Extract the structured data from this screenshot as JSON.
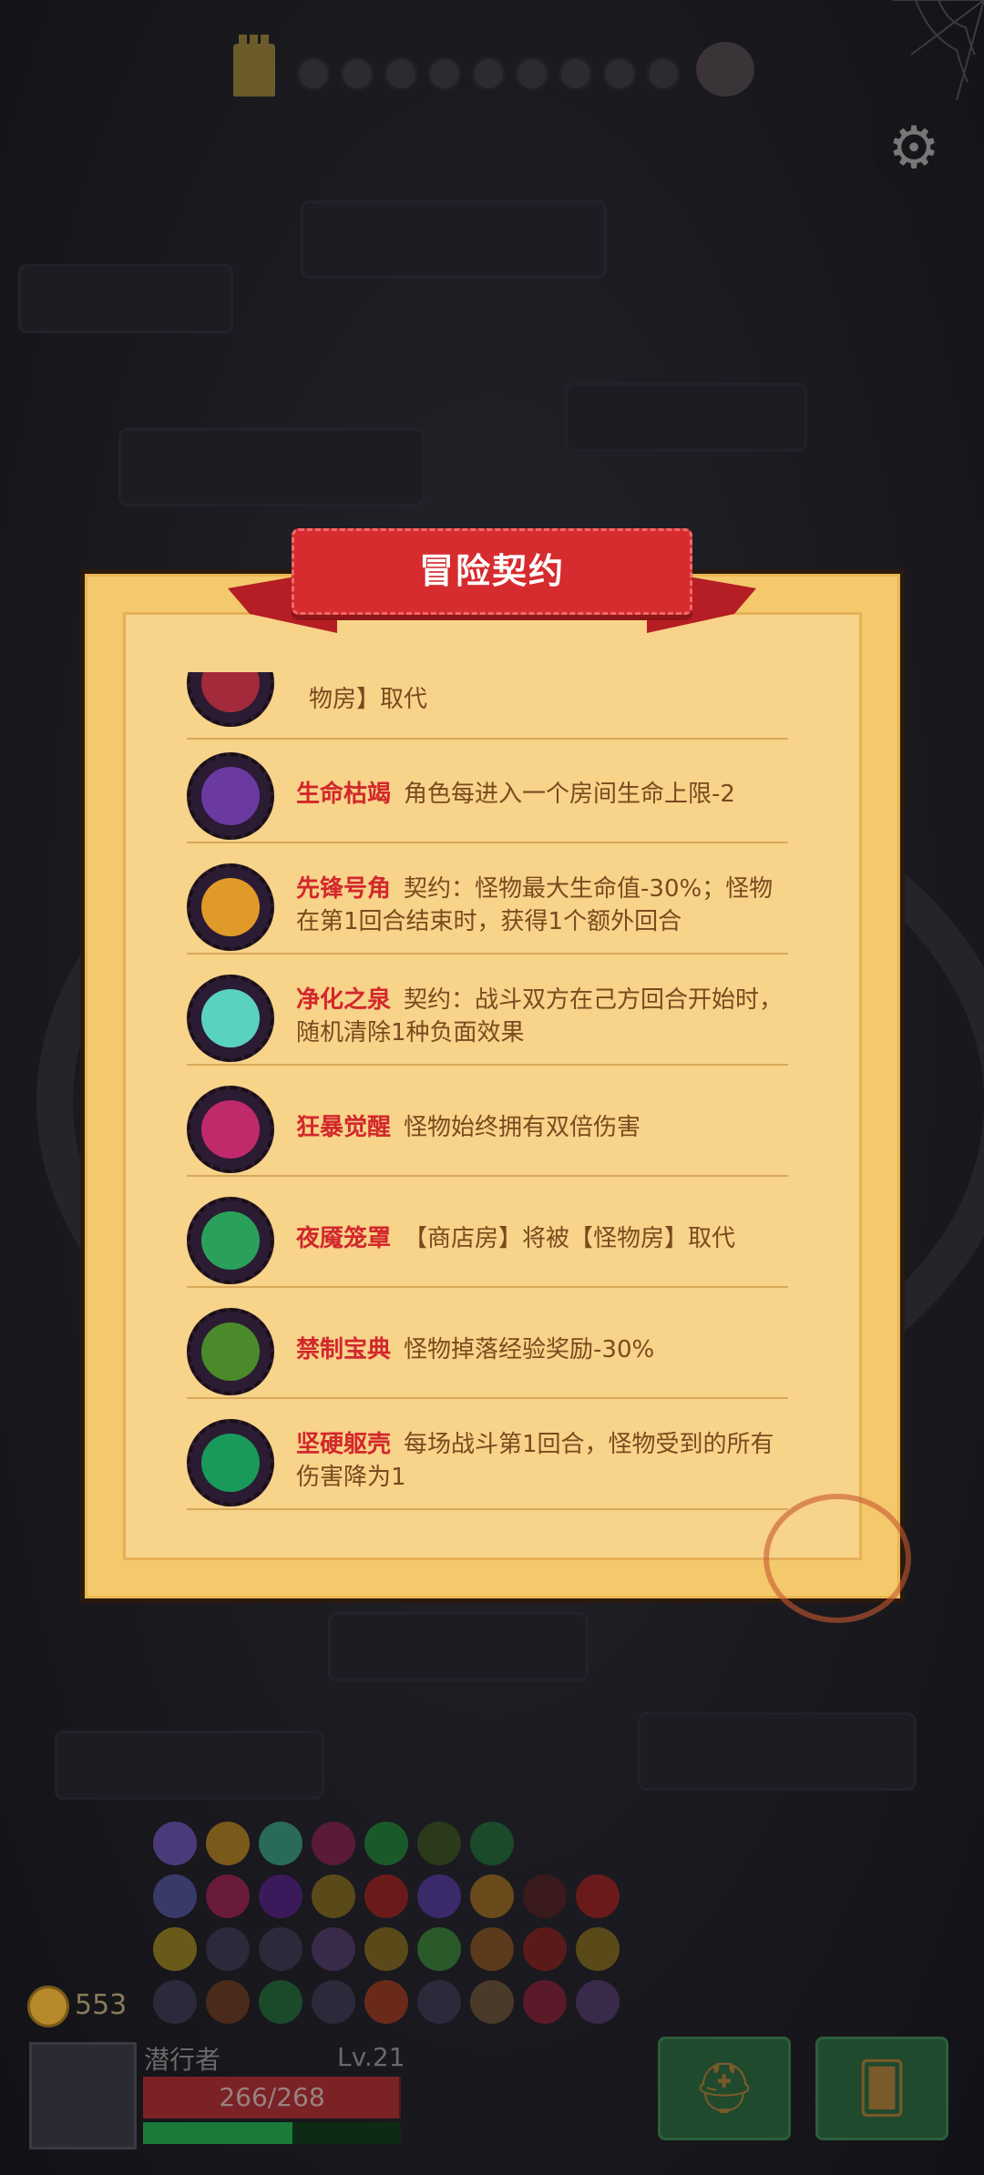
{
  "dialog": {
    "title": "冒险契约",
    "items": [
      {
        "name": "",
        "desc": "物房】取代",
        "icon": "crimson-beast-icon",
        "color": "#a32a3a"
      },
      {
        "name": "生命枯竭",
        "desc": "角色每进入一个房间生命上限-2",
        "icon": "withered-lamp-icon",
        "color": "#6a3aa0"
      },
      {
        "name": "先锋号角",
        "desc": "契约：怪物最大生命值-30%；怪物在第1回合结束时，获得1个额外回合",
        "icon": "horn-icon",
        "color": "#e09a2a"
      },
      {
        "name": "净化之泉",
        "desc": "契约：战斗双方在己方回合开始时，随机清除1种负面效果",
        "icon": "spring-splash-icon",
        "color": "#5ad2c0"
      },
      {
        "name": "狂暴觉醒",
        "desc": "怪物始终拥有双倍伤害",
        "icon": "rage-eye-icon",
        "color": "#c02a6a"
      },
      {
        "name": "夜魇笼罩",
        "desc": "【商店房】将被【怪物房】取代",
        "icon": "nightmare-monster-icon",
        "color": "#2aa05a"
      },
      {
        "name": "禁制宝典",
        "desc": "怪物掉落经验奖励-30%",
        "icon": "forbidden-tome-icon",
        "color": "#4a8a2a"
      },
      {
        "name": "坚硬躯壳",
        "desc": "每场战斗第1回合，怪物受到的所有伤害降为1",
        "icon": "hard-shell-icon",
        "color": "#1a9a5a"
      }
    ]
  },
  "player": {
    "name": "潜行者",
    "level": "Lv.21",
    "hp": "266/268",
    "hp_fraction": 0.9925,
    "xp_fraction": 0.58,
    "coins": "553"
  },
  "icons": {
    "settings": "gear-icon",
    "tower": "tower-icon",
    "boss": "boss-skull-icon",
    "equipment": "helmet-icon",
    "cards": "cards-icon"
  }
}
